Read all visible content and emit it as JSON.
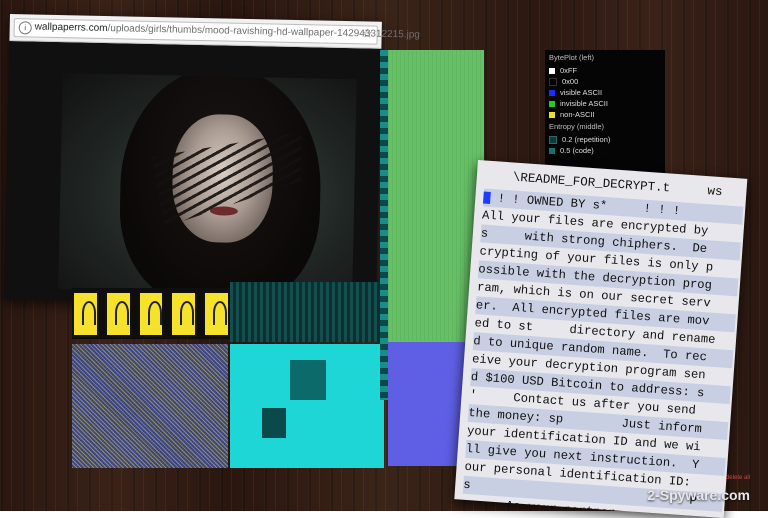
{
  "browser": {
    "url_host": "wallpaperrs.com",
    "url_path": "/uploads/girls/thumbs/mood-ravishing-hd-wallpaper-142943312215.jpg"
  },
  "legend": {
    "title_left": "BytePlot (left)",
    "items": [
      {
        "label": "0xFF",
        "color": "#ffffff"
      },
      {
        "label": "0x00",
        "color": "#000000"
      },
      {
        "label": "visible ASCII",
        "color": "#1a2cff"
      },
      {
        "label": "invisible ASCII",
        "color": "#22cc22"
      },
      {
        "label": "non-ASCII",
        "color": "#f0e020"
      }
    ],
    "title_middle": "Entropy (middle)",
    "entropy_items": [
      {
        "label": "0.2 (repetition)",
        "color": "#0d3b3b"
      },
      {
        "label": "0.5 (code)",
        "color": "#1a6e6e"
      }
    ]
  },
  "note": {
    "title": "\\README_FOR_DECRYPT.t     ws",
    "lines": [
      " ! ! OWNED BY s*     ! ! !",
      "All your files are encrypted by",
      "s     with strong chiphers.  De",
      "crypting of your files is only p",
      "ossible with the decryption prog",
      "ram, which is on our secret serv",
      "er.  All encrypted files are mov",
      "ed to st     directory and rename",
      "d to unique random name.  To rec",
      "eive your decryption program sen",
      "d $100 USD Bitcoin to address: s",
      "'     Contact us after you send",
      "the money: sp        Just inform",
      "your identification ID and we wi",
      "ll give you next instruction.  Y",
      "our personal identification ID:",
      "s                              P",
      "      As your partner"
    ]
  },
  "watermark": {
    "text": "2-Spyware.com",
    "sub": "delete all"
  }
}
